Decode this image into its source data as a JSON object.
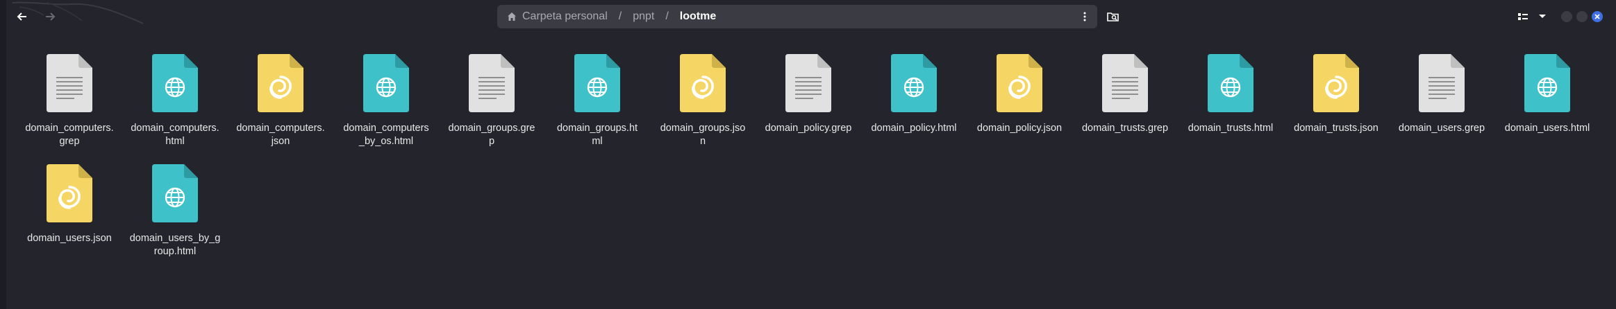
{
  "window": {
    "breadcrumb": [
      {
        "label": "Carpeta personal"
      },
      {
        "label": "pnpt"
      },
      {
        "label": "lootme"
      }
    ],
    "separator": "/"
  },
  "icons": {
    "back": "arrow-left-icon",
    "forward": "arrow-right-icon",
    "home": "home-icon",
    "menu": "kebab-menu-icon",
    "search": "folder-search-icon",
    "view": "view-list-icon",
    "dropdown": "chevron-down-icon"
  },
  "colors": {
    "grep_file": "#e1e1e1",
    "html_file": "#3fc1c9",
    "json_file": "#f5d664",
    "close_button": "#3e6fe3"
  },
  "files": [
    {
      "name": "domain_computers.\ngrep",
      "type": "grep"
    },
    {
      "name": "domain_computers.\nhtml",
      "type": "html"
    },
    {
      "name": "domain_computers.\njson",
      "type": "json"
    },
    {
      "name": "domain_computers\n_by_os.html",
      "type": "html"
    },
    {
      "name": "domain_groups.gre\np",
      "type": "grep"
    },
    {
      "name": "domain_groups.ht\nml",
      "type": "html"
    },
    {
      "name": "domain_groups.jso\nn",
      "type": "json"
    },
    {
      "name": "domain_policy.grep",
      "type": "grep"
    },
    {
      "name": "domain_policy.html",
      "type": "html"
    },
    {
      "name": "domain_policy.json",
      "type": "json"
    },
    {
      "name": "domain_trusts.grep",
      "type": "grep"
    },
    {
      "name": "domain_trusts.html",
      "type": "html"
    },
    {
      "name": "domain_trusts.json",
      "type": "json"
    },
    {
      "name": "domain_users.grep",
      "type": "grep"
    },
    {
      "name": "domain_users.html",
      "type": "html"
    },
    {
      "name": "domain_users.json",
      "type": "json"
    },
    {
      "name": "domain_users_by_g\nroup.html",
      "type": "html"
    }
  ]
}
